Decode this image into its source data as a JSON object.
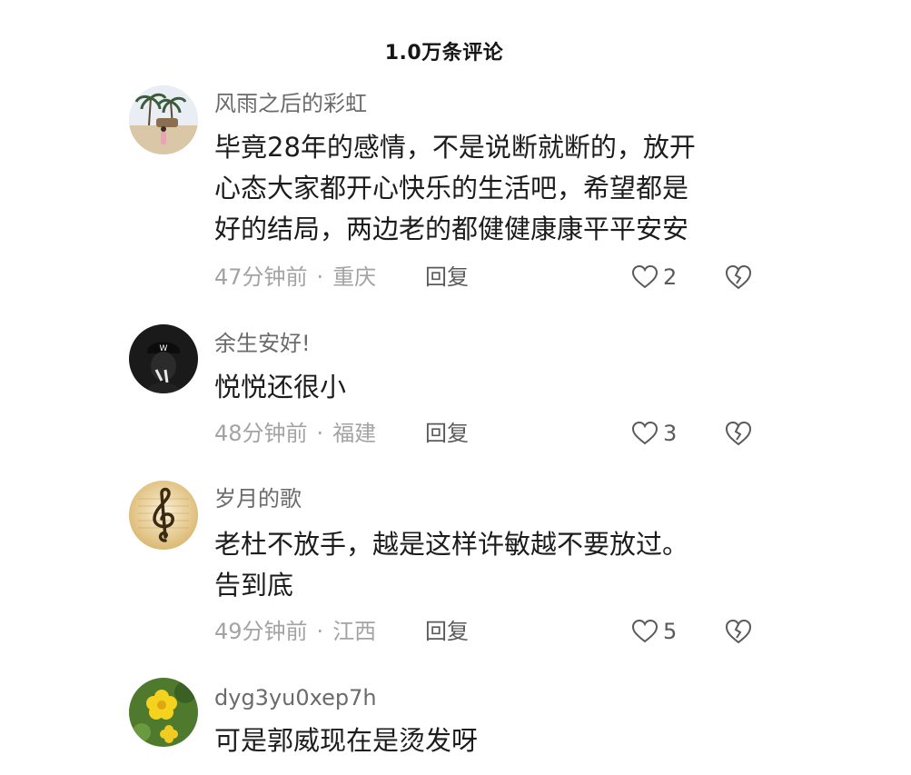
{
  "header": {
    "title": "1.0万条评论"
  },
  "comments": [
    {
      "username": "风雨之后的彩虹",
      "lines": [
        "毕竟28年的感情，不是说断就断的，放开",
        "心态大家都开心快乐的生活吧，希望都是",
        "好的结局，两边老的都健健康康平平安安"
      ],
      "time": "47分钟前",
      "dot": "·",
      "location": "重庆",
      "reply": "回复",
      "likes": "2",
      "avatar_icon": "beach-palm-avatar"
    },
    {
      "username": "余生安好!",
      "lines": [
        "悦悦还很小"
      ],
      "time": "48分钟前",
      "dot": "·",
      "location": "福建",
      "reply": "回复",
      "likes": "3",
      "avatar_icon": "dark-cap-avatar"
    },
    {
      "username": "岁月的歌",
      "lines": [
        "老杜不放手，越是这样许敏越不要放过。",
        "告到底"
      ],
      "time": "49分钟前",
      "dot": "·",
      "location": "江西",
      "reply": "回复",
      "likes": "5",
      "avatar_icon": "treble-clef-avatar"
    },
    {
      "username": "dyg3yu0xep7h",
      "lines": [
        "可是郭威现在是烫发呀"
      ],
      "avatar_icon": "yellow-flower-avatar"
    }
  ],
  "colors": {
    "username": "#6b6b6b",
    "text": "#1c1c1c",
    "meta": "#a3a3a3",
    "action": "#5a5a5a"
  }
}
